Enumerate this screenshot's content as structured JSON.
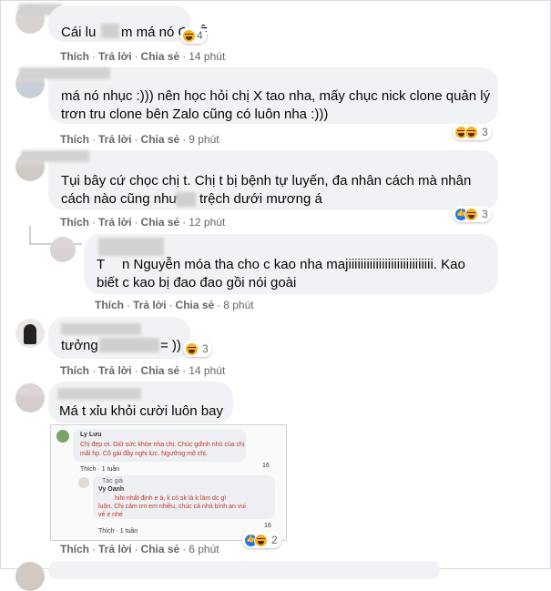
{
  "actions": {
    "like": "Thích",
    "reply": "Trả lời",
    "share": "Chia sẻ",
    "sep": "·"
  },
  "comments": [
    {
      "text": [
        "Cái lu",
        "m má nó QUÊ"
      ],
      "reaction_count": "4",
      "time": "14 phút"
    },
    {
      "text": [
        "má nó nhục :))) nên học hỏi chị X tao nha, mấy chục nick clone quản lý",
        "trơn tru clone bên Zalo cũng có luôn nha :)))"
      ],
      "reaction_count": "3",
      "time": "9 phút"
    },
    {
      "text": [
        "Tụi bây cứ chọc chị t. Chị t bị bệnh tự luyến, đa nhân cách mà nhân",
        "cách nào cũng như",
        "trệch dưới mương á"
      ],
      "reaction_count": "3",
      "time": "12 phút"
    },
    {
      "text": [
        "T",
        "n Nguyễn móa tha cho c kao nha majiiiiiiiiiiiiiiiiiiiiiiiiiiii. Kao",
        "biết c kao bị đao đao gồi nói goài"
      ],
      "time": "8 phút"
    },
    {
      "text": [
        "tưởng",
        "= ))"
      ],
      "reaction_count": "3",
      "time": "14 phút"
    },
    {
      "text": [
        "Má t xỉu khỏi cười luôn bay"
      ],
      "time": "6 phút"
    }
  ],
  "embedded_screenshot": {
    "c1_name": "Ly Lưu",
    "c1_text": [
      "Chị đẹp ơi. Giữ sức khỏe nha chị. Chúc gdình nhỏ của chị",
      "mãi hp. Cô gái đầy nghị lực. Ngưỡng mộ chị."
    ],
    "c1_count": "16",
    "c1_actions": "Thích · 1 tuần",
    "reply_tag": "Tác giả",
    "c2_name": "Vy Oanh",
    "c2_text": [
      "hihi nhất định e à, k có sk là k làm dc gì",
      "luôn. Chị cảm ơn em nhiều, chúc cả nhà bình an vui",
      "vẻ e nhé"
    ],
    "c2_count": "16",
    "c2_actions": "Thích · 1 tuần"
  },
  "last_reaction_count": "2",
  "colors": {
    "bubble": "#f0f2f5",
    "meta": "#65676b",
    "text": "#050505",
    "like_blue": "#1877f2",
    "haha_yellow": "#f7b125"
  }
}
